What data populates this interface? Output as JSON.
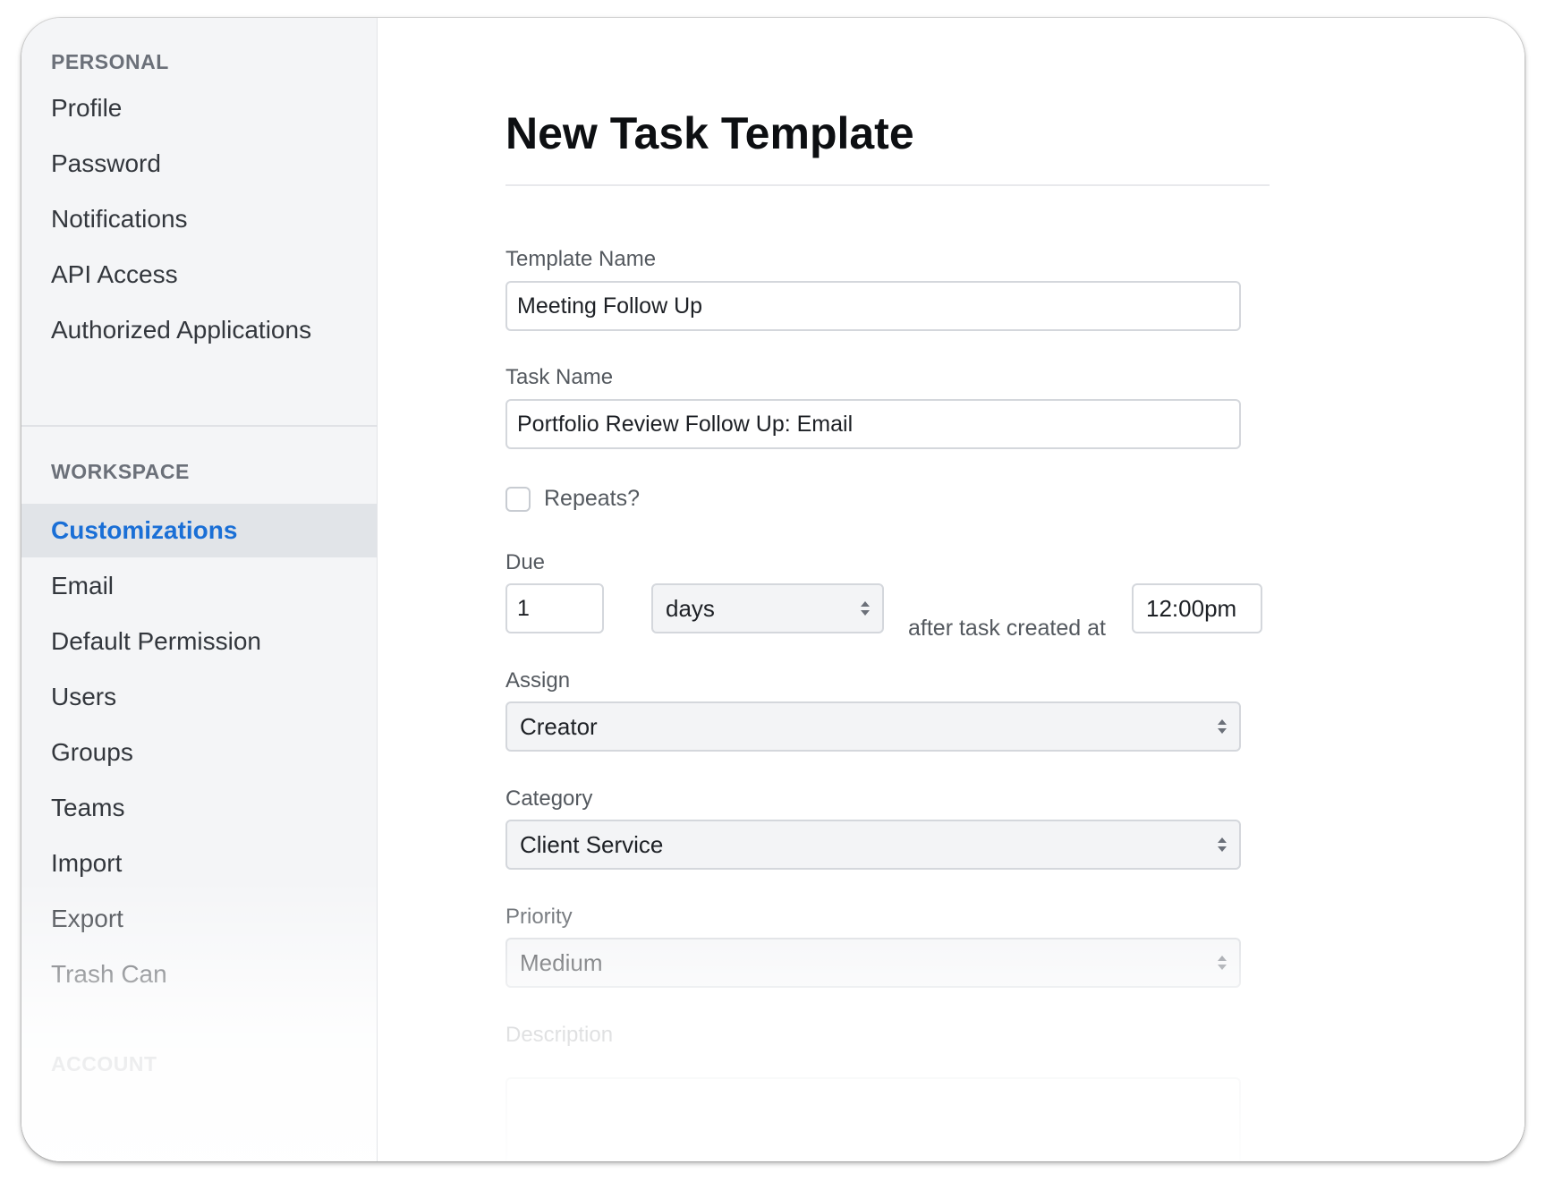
{
  "sidebar": {
    "personal_heading": "PERSONAL",
    "personal_items": [
      "Profile",
      "Password",
      "Notifications",
      "API Access",
      "Authorized Applications"
    ],
    "workspace_heading": "WORKSPACE",
    "workspace_items": [
      "Customizations",
      "Email",
      "Default Permission",
      "Users",
      "Groups",
      "Teams",
      "Import",
      "Export",
      "Trash Can"
    ],
    "active_item": "Customizations",
    "account_heading": "ACCOUNT"
  },
  "main": {
    "title": "New Task Template",
    "template_name": {
      "label": "Template Name",
      "value": "Meeting Follow Up"
    },
    "task_name": {
      "label": "Task Name",
      "value": "Portfolio Review Follow Up: Email"
    },
    "repeats": {
      "label": "Repeats?",
      "checked": false
    },
    "due": {
      "label": "Due",
      "amount": "1",
      "unit": "days",
      "connector": "after task created at",
      "time": "12:00pm"
    },
    "assign": {
      "label": "Assign",
      "value": "Creator"
    },
    "category": {
      "label": "Category",
      "value": "Client Service"
    },
    "priority": {
      "label": "Priority",
      "value": "Medium"
    },
    "description": {
      "label": "Description",
      "value": ""
    }
  },
  "colors": {
    "accent": "#1a6fd6",
    "sidebar_bg": "#f4f5f7",
    "active_bg": "#e1e4e8"
  },
  "icons": {
    "select_arrows": "up-down-chevron-icon"
  }
}
